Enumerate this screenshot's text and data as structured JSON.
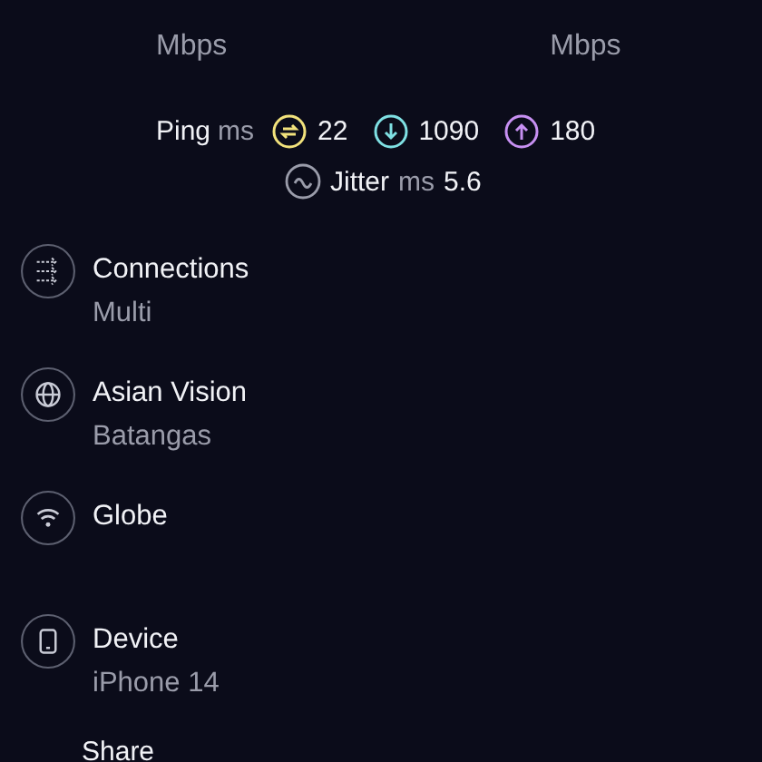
{
  "speeds": [
    {
      "unit": "Mbps"
    },
    {
      "unit": "Mbps"
    }
  ],
  "ping": {
    "label": "Ping",
    "unit": "ms",
    "values": [
      {
        "kind": "idle",
        "value": "22",
        "color": "#f2e27c"
      },
      {
        "kind": "download",
        "value": "1090",
        "color": "#7fe0e3"
      },
      {
        "kind": "upload",
        "value": "180",
        "color": "#c790f2"
      }
    ]
  },
  "jitter": {
    "label": "Jitter",
    "unit": "ms",
    "value": "5.6"
  },
  "details": [
    {
      "kind": "connections",
      "title": "Connections",
      "subtitle": "Multi"
    },
    {
      "kind": "globe",
      "title": "Asian Vision",
      "subtitle": "Batangas"
    },
    {
      "kind": "wifi",
      "title": "Globe"
    },
    {
      "kind": "device",
      "title": "Device",
      "subtitle": "iPhone 14"
    }
  ],
  "share": {
    "label": "Share"
  }
}
